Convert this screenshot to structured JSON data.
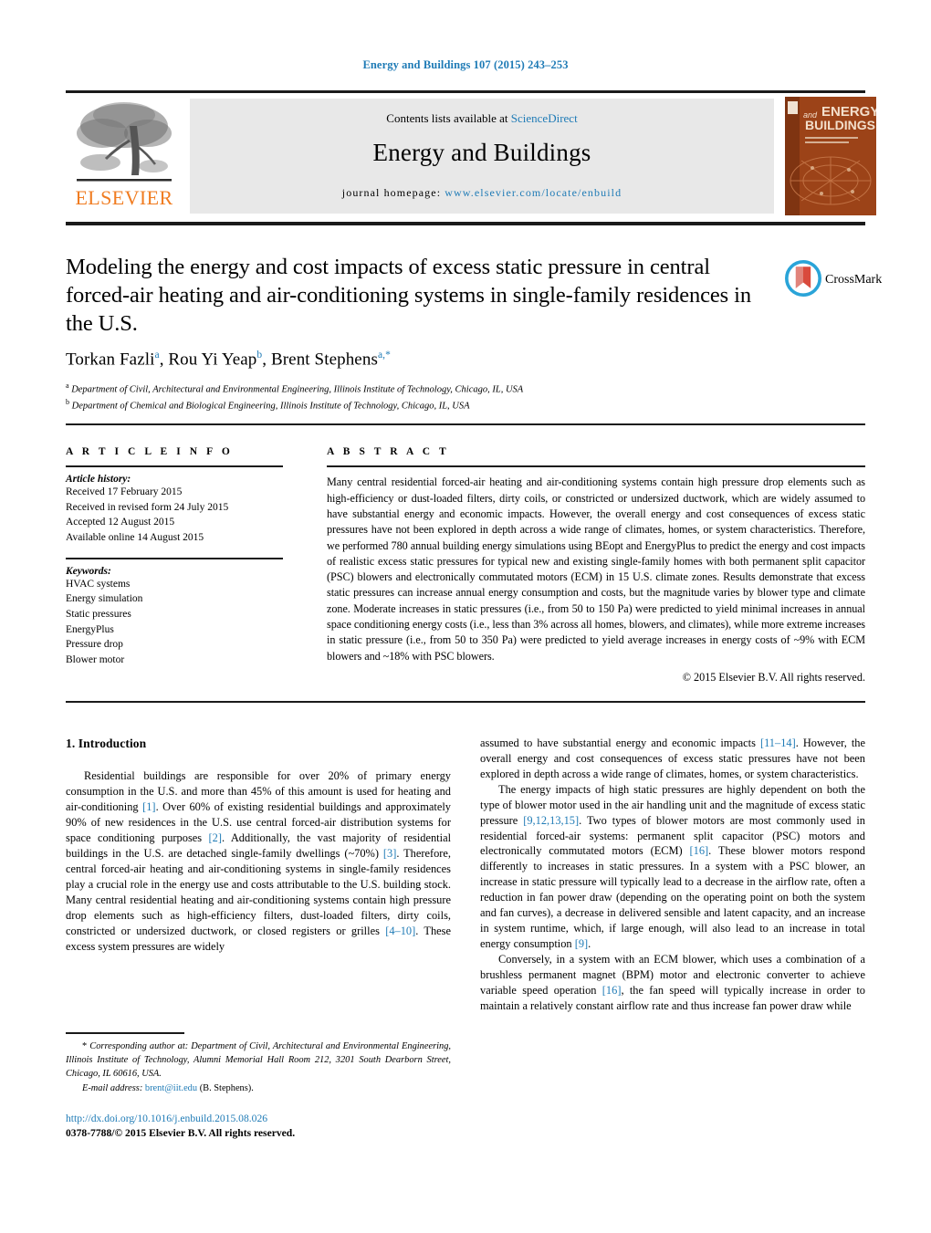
{
  "running_head": "Energy and Buildings 107 (2015) 243–253",
  "masthead": {
    "contents_prefix": "Contents lists available at ",
    "sciencedirect": "ScienceDirect",
    "journal_title": "Energy and Buildings",
    "homepage_prefix": "journal homepage: ",
    "homepage_url": "www.elsevier.com/locate/enbuild",
    "publisher": "ELSEVIER",
    "cover_and": "and",
    "cover_energy": "ENERGY",
    "cover_buildings": "BUILDINGS"
  },
  "crossmark": {
    "label": "CrossMark"
  },
  "title": "Modeling the energy and cost impacts of excess static pressure in central forced-air heating and air-conditioning systems in single-family residences in the U.S.",
  "authors_html": "Torkan Fazli<sup>a</sup>, Rou Yi Yeap<sup>b</sup>, Brent Stephens<sup>a,*</sup>",
  "affiliations": [
    {
      "marker": "a",
      "text": "Department of Civil, Architectural and Environmental Engineering, Illinois Institute of Technology, Chicago, IL, USA"
    },
    {
      "marker": "b",
      "text": "Department of Chemical and Biological Engineering, Illinois Institute of Technology, Chicago, IL, USA"
    }
  ],
  "article_info": {
    "heading": "A R T I C L E   I N F O",
    "history_label": "Article history:",
    "history": [
      "Received 17 February 2015",
      "Received in revised form 24 July 2015",
      "Accepted 12 August 2015",
      "Available online 14 August 2015"
    ],
    "keywords_label": "Keywords:",
    "keywords": [
      "HVAC systems",
      "Energy simulation",
      "Static pressures",
      "EnergyPlus",
      "Pressure drop",
      "Blower motor"
    ]
  },
  "abstract": {
    "heading": "A B S T R A C T",
    "body": "Many central residential forced-air heating and air-conditioning systems contain high pressure drop elements such as high-efficiency or dust-loaded filters, dirty coils, or constricted or undersized ductwork, which are widely assumed to have substantial energy and economic impacts. However, the overall energy and cost consequences of excess static pressures have not been explored in depth across a wide range of climates, homes, or system characteristics. Therefore, we performed 780 annual building energy simulations using BEopt and EnergyPlus to predict the energy and cost impacts of realistic excess static pressures for typical new and existing single-family homes with both permanent split capacitor (PSC) blowers and electronically commutated motors (ECM) in 15 U.S. climate zones. Results demonstrate that excess static pressures can increase annual energy consumption and costs, but the magnitude varies by blower type and climate zone. Moderate increases in static pressures (i.e., from 50 to 150 Pa) were predicted to yield minimal increases in annual space conditioning energy costs (i.e., less than 3% across all homes, blowers, and climates), while more extreme increases in static pressure (i.e., from 50 to 350 Pa) were predicted to yield average increases in energy costs of ~9% with ECM blowers and ~18% with PSC blowers.",
    "copyright": "© 2015 Elsevier B.V. All rights reserved."
  },
  "body": {
    "section_number_title": "1.  Introduction",
    "left_paragraphs_html": [
      "Residential buildings are responsible for over 20% of primary energy consumption in the U.S. and more than 45% of this amount is used for heating and air-conditioning <span class=\"ref\">[1]</span>. Over 60% of existing residential buildings and approximately 90% of new residences in the U.S. use central forced-air distribution systems for space conditioning purposes <span class=\"ref\">[2]</span>. Additionally, the vast majority of residential buildings in the U.S. are detached single-family dwellings (~70%) <span class=\"ref\">[3]</span>. Therefore, central forced-air heating and air-conditioning systems in single-family residences play a crucial role in the energy use and costs attributable to the U.S. building stock. Many central residential heating and air-conditioning systems contain high pressure drop elements such as high-efficiency filters, dust-loaded filters, dirty coils, constricted or undersized ductwork, or closed registers or grilles <span class=\"ref\">[4–10]</span>. These excess system pressures are widely"
    ],
    "right_paragraphs_html": [
      "assumed to have substantial energy and economic impacts <span class=\"ref\">[11–14]</span>. However, the overall energy and cost consequences of excess static pressures have not been explored in depth across a wide range of climates, homes, or system characteristics.",
      "The energy impacts of high static pressures are highly dependent on both the type of blower motor used in the air handling unit and the magnitude of excess static pressure <span class=\"ref\">[9,12,13,15]</span>. Two types of blower motors are most commonly used in residential forced-air systems: permanent split capacitor (PSC) motors and electronically commutated motors (ECM) <span class=\"ref\">[16]</span>. These blower motors respond differently to increases in static pressures. In a system with a PSC blower, an increase in static pressure will typically lead to a decrease in the airflow rate, often a reduction in fan power draw (depending on the operating point on both the system and fan curves), a decrease in delivered sensible and latent capacity, and an increase in system runtime, which, if large enough, will also lead to an increase in total energy consumption <span class=\"ref\">[9]</span>.",
      "Conversely, in a system with an ECM blower, which uses a combination of a brushless permanent magnet (BPM) motor and electronic converter to achieve variable speed operation <span class=\"ref\">[16]</span>, the fan speed will typically increase in order to maintain a relatively constant airflow rate and thus increase fan power draw while"
    ]
  },
  "footnote": {
    "corresponding_html": "<span class=\"fn-star\">*</span> Corresponding author at: Department of Civil, Architectural and Environmental Engineering, Illinois Institute of Technology, Alumni Memorial Hall Room 212, 3201 South Dearborn Street, Chicago, IL 60616, USA.",
    "email_html": "<span>E-mail address:</span> <span class=\"em-addr\">brent@iit.edu</span> <span class=\"em-who\">(B. Stephens).</span>"
  },
  "doi": {
    "url": "http://dx.doi.org/10.1016/j.enbuild.2015.08.026",
    "issn_line": "0378-7788/© 2015 Elsevier B.V. All rights reserved."
  },
  "colors": {
    "link_blue": "#1f7bb6",
    "elsevier_orange": "#f07c21",
    "panel_grey": "#e8e8e8",
    "cover_brown": "#9a3d16"
  }
}
